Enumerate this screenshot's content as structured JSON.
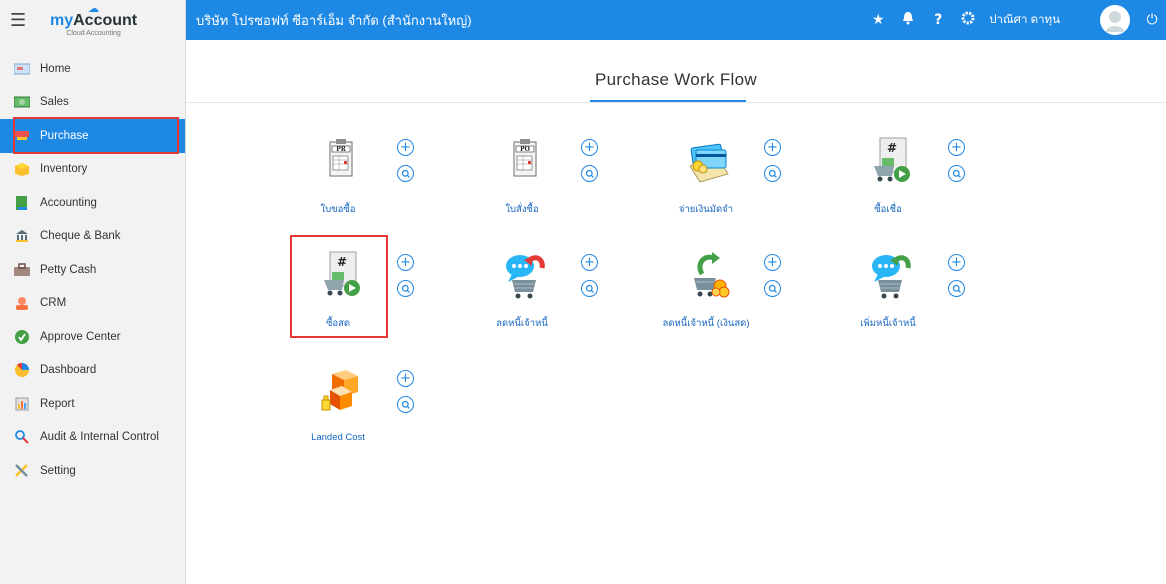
{
  "app": {
    "logo_text_1": "my",
    "logo_text_2": "Account",
    "logo_sub": "Cloud Accounting"
  },
  "topbar": {
    "company": "บริษัท โปรซอฟท์ ซีอาร์เอ็ม จำกัด (สำนักงานใหญ่)",
    "user_name": "ปาณิศา ดาทุน",
    "icons": [
      "star-icon",
      "bell-icon",
      "help-icon",
      "settings-icon",
      "power-icon"
    ]
  },
  "sidebar": {
    "items": [
      {
        "label": "Home",
        "icon": "home-icon"
      },
      {
        "label": "Sales",
        "icon": "sales-icon"
      },
      {
        "label": "Purchase",
        "icon": "purchase-icon",
        "active": true
      },
      {
        "label": "Inventory",
        "icon": "inventory-icon"
      },
      {
        "label": "Accounting",
        "icon": "accounting-icon"
      },
      {
        "label": "Cheque & Bank",
        "icon": "bank-icon"
      },
      {
        "label": "Petty Cash",
        "icon": "petty-cash-icon"
      },
      {
        "label": "CRM",
        "icon": "crm-icon"
      },
      {
        "label": "Approve Center",
        "icon": "approve-icon"
      },
      {
        "label": "Dashboard",
        "icon": "dashboard-icon"
      },
      {
        "label": "Report",
        "icon": "report-icon"
      },
      {
        "label": "Audit & Internal Control",
        "icon": "audit-icon"
      },
      {
        "label": "Setting",
        "icon": "setting-icon"
      }
    ]
  },
  "main": {
    "title": "Purchase Work Flow",
    "tiles": [
      {
        "label": "ใบขอซื้อ",
        "icon": "purchase-request-icon",
        "badge": "PR"
      },
      {
        "label": "ใบสั่งซื้อ",
        "icon": "purchase-order-icon",
        "badge": "PO"
      },
      {
        "label": "จ่ายเงินมัดจำ",
        "icon": "deposit-payment-icon"
      },
      {
        "label": "ซื้อเชื่อ",
        "icon": "credit-purchase-icon",
        "badge": "#"
      },
      {
        "label": "ซื้อสด",
        "icon": "cash-purchase-icon",
        "badge": "#"
      },
      {
        "label": "ลดหนี้เจ้าหนี้",
        "icon": "debit-note-icon"
      },
      {
        "label": "ลดหนี้เจ้าหนี้ (เงินสด)",
        "icon": "cash-debit-note-icon"
      },
      {
        "label": "เพิ่มหนี้เจ้าหนี้",
        "icon": "credit-note-icon"
      },
      {
        "label": "Landed Cost",
        "icon": "landed-cost-icon"
      }
    ],
    "add_symbol": "+",
    "search_symbol": "Q"
  }
}
